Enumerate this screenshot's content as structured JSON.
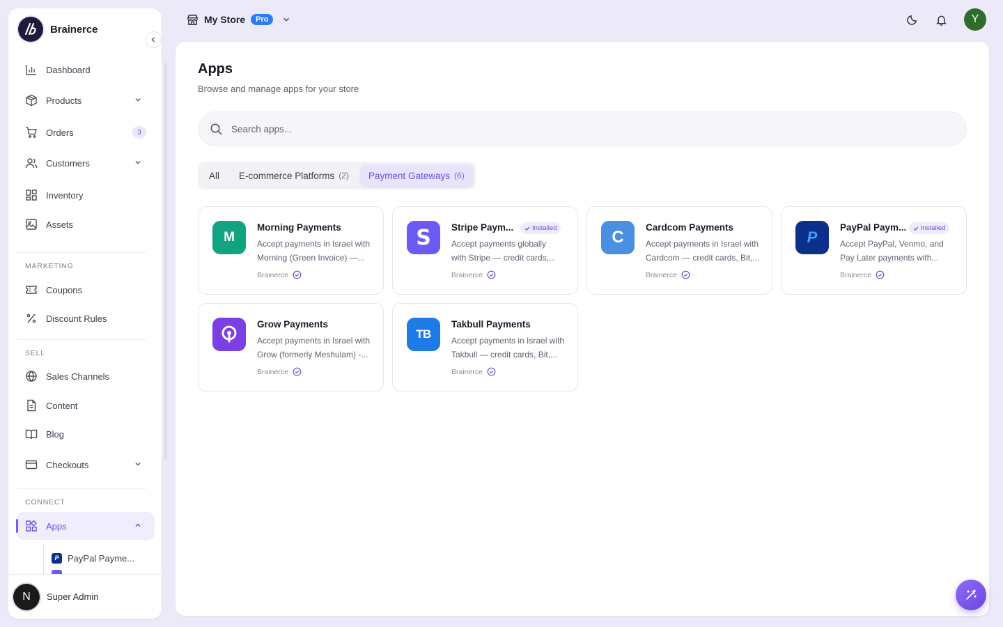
{
  "brand": {
    "name": "Brainerce"
  },
  "topbar": {
    "store_name": "My Store",
    "plan_badge": "Pro",
    "user_initial": "Y"
  },
  "sidebar": {
    "items": [
      {
        "label": "Dashboard"
      },
      {
        "label": "Products"
      },
      {
        "label": "Orders",
        "badge": "3"
      },
      {
        "label": "Customers"
      },
      {
        "label": "Inventory"
      },
      {
        "label": "Assets"
      }
    ],
    "marketing_title": "MARKETING",
    "marketing": [
      {
        "label": "Coupons"
      },
      {
        "label": "Discount Rules"
      }
    ],
    "sell_title": "SELL",
    "sell": [
      {
        "label": "Sales Channels"
      },
      {
        "label": "Content"
      },
      {
        "label": "Blog"
      },
      {
        "label": "Checkouts"
      }
    ],
    "connect_title": "CONNECT",
    "connect": [
      {
        "label": "Apps"
      }
    ],
    "apps_sub": [
      {
        "label": "PayPal Payme..."
      }
    ],
    "footer": {
      "avatar_initial": "N",
      "name": "Super Admin"
    }
  },
  "main": {
    "title": "Apps",
    "subtitle": "Browse and manage apps for your store",
    "search_placeholder": "Search apps...",
    "tabs": [
      {
        "label": "All",
        "count": ""
      },
      {
        "label": "E-commerce Platforms",
        "count": "(2)"
      },
      {
        "label": "Payment Gateways",
        "count": "(6)"
      }
    ],
    "active_tab": "Payment Gateways",
    "installed_label": "Installed",
    "apps": [
      {
        "name": "Morning Payments",
        "logo_text": "M",
        "color": "#12a383",
        "installed": false,
        "desc_line1": "Accept payments in Israel with",
        "desc_line2": "Morning (Green Invoice) —...",
        "vendor": "Brainerce"
      },
      {
        "name": "Stripe Paym...",
        "logo_text": "S",
        "color": "#6b5bf2",
        "installed": true,
        "desc_line1": "Accept payments globally",
        "desc_line2": "with Stripe — credit cards,...",
        "vendor": "Brainerce"
      },
      {
        "name": "Cardcom Payments",
        "logo_text": "C",
        "color": "#4a90e2",
        "installed": false,
        "desc_line1": "Accept payments in Israel with",
        "desc_line2": "Cardcom — credit cards, Bit,...",
        "vendor": "Brainerce"
      },
      {
        "name": "PayPal Paym...",
        "logo_text": "P",
        "color": "#0b2f8a",
        "installed": true,
        "desc_line1": "Accept PayPal, Venmo, and",
        "desc_line2": "Pay Later payments with...",
        "vendor": "Brainerce"
      },
      {
        "name": "Grow Payments",
        "logo_text": "",
        "color": "#7b3fe4",
        "installed": false,
        "desc_line1": "Accept payments in Israel with",
        "desc_line2": "Grow (formerly Meshulam) -...",
        "vendor": "Brainerce"
      },
      {
        "name": "Takbull Payments",
        "logo_text": "TB",
        "color": "#1e7be6",
        "installed": false,
        "desc_line1": "Accept payments in Israel with",
        "desc_line2": "Takbull — credit cards, Bit,...",
        "vendor": "Brainerce"
      }
    ]
  },
  "colors": {
    "accent": "#6a4fd4",
    "background": "#eceaf8"
  }
}
